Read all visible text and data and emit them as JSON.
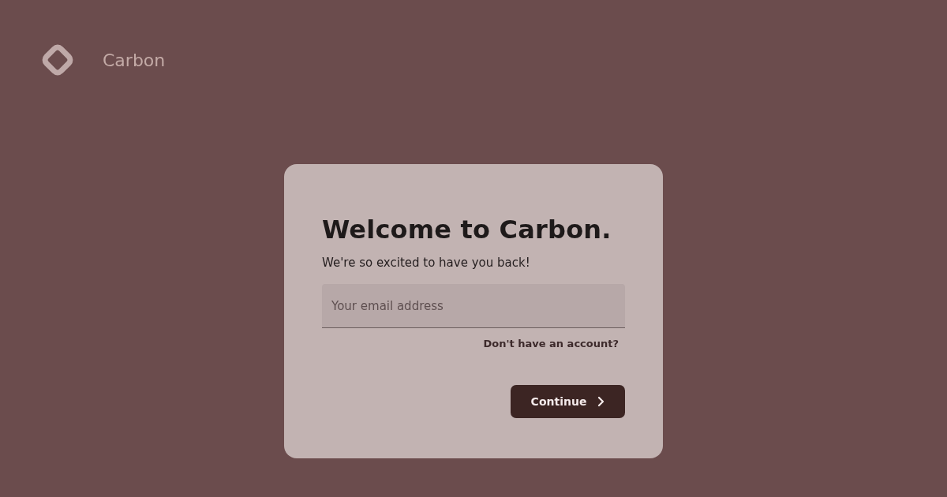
{
  "brand": {
    "name": "Carbon"
  },
  "card": {
    "title": "Welcome to Carbon.",
    "subtitle": "We're so excited to have you back!",
    "email": {
      "placeholder": "Your email address"
    },
    "signup_link": "Don't have an account?",
    "button": "Continue"
  }
}
